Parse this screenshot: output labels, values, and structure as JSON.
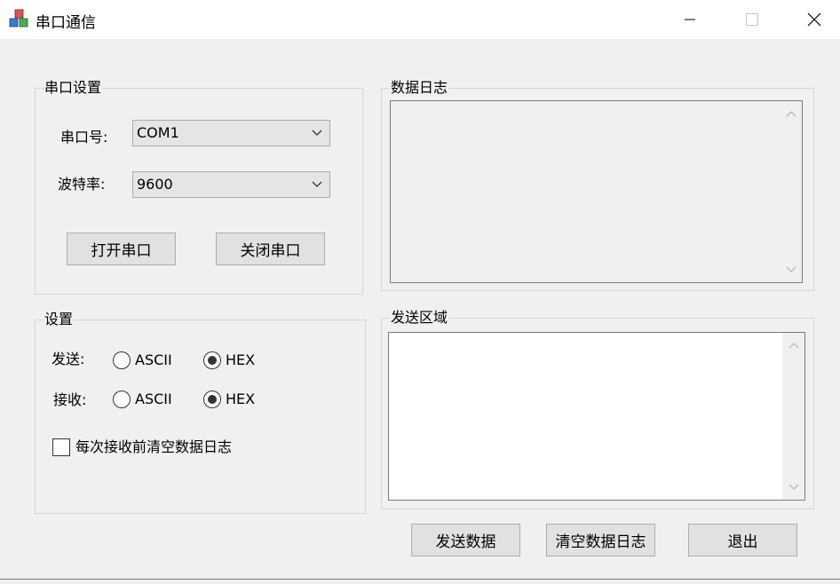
{
  "window": {
    "title": "串口通信"
  },
  "serial_group": {
    "title": "串口设置",
    "port_label": "串口号:",
    "port_value": "COM1",
    "baud_label": "波特率:",
    "baud_value": "9600",
    "open_button": "打开串口",
    "close_button": "关闭串口"
  },
  "settings_group": {
    "title": "设置",
    "send_label": "发送:",
    "receive_label": "接收:",
    "ascii": "ASCII",
    "hex": "HEX",
    "send_selected": "HEX",
    "receive_selected": "HEX",
    "clear_log_checkbox": "每次接收前清空数据日志",
    "clear_log_checked": false
  },
  "log_group": {
    "title": "数据日志",
    "content": ""
  },
  "send_group": {
    "title": "发送区域",
    "content": ""
  },
  "actions": {
    "send_button": "发送数据",
    "clear_button": "清空数据日志",
    "exit_button": "退出"
  }
}
